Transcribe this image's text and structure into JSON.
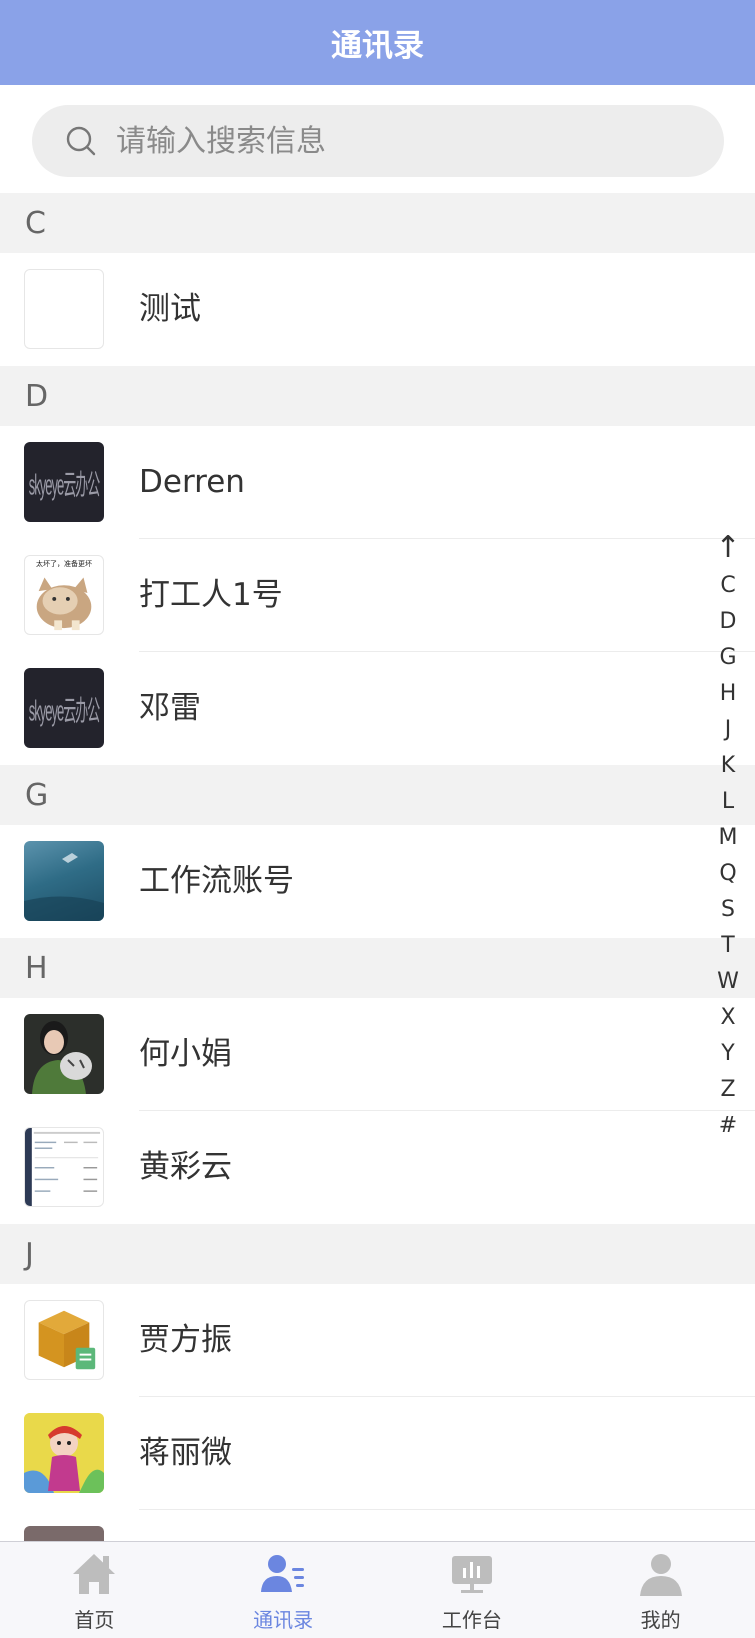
{
  "header": {
    "title": "通讯录"
  },
  "search": {
    "placeholder": "请输入搜索信息",
    "icon": "search-icon"
  },
  "sections": [
    {
      "letter": "C",
      "contacts": [
        {
          "name": "测试",
          "avatar": "blank"
        }
      ]
    },
    {
      "letter": "D",
      "contacts": [
        {
          "name": "Derren",
          "avatar": "skyeye-logo"
        },
        {
          "name": "打工人1号",
          "avatar": "cat-photo",
          "avatar_text": "太坏了，准备更坏"
        },
        {
          "name": "邓雷",
          "avatar": "skyeye-logo"
        }
      ]
    },
    {
      "letter": "G",
      "contacts": [
        {
          "name": "工作流账号",
          "avatar": "ocean-photo"
        }
      ]
    },
    {
      "letter": "H",
      "contacts": [
        {
          "name": "何小娟",
          "avatar": "person-photo"
        },
        {
          "name": "黄彩云",
          "avatar": "screenshot-thumb"
        }
      ]
    },
    {
      "letter": "J",
      "contacts": [
        {
          "name": "贾方振",
          "avatar": "box-icon"
        },
        {
          "name": "蒋丽微",
          "avatar": "cartoon"
        }
      ]
    }
  ],
  "logo_text": "skyeye云办公",
  "index_bar": [
    "↑",
    "C",
    "D",
    "G",
    "H",
    "J",
    "K",
    "L",
    "M",
    "Q",
    "S",
    "T",
    "W",
    "X",
    "Y",
    "Z",
    "#"
  ],
  "tabs": [
    {
      "label": "首页",
      "icon": "home-icon",
      "active": false
    },
    {
      "label": "通讯录",
      "icon": "contacts-icon",
      "active": true
    },
    {
      "label": "工作台",
      "icon": "workbench-icon",
      "active": false
    },
    {
      "label": "我的",
      "icon": "profile-icon",
      "active": false
    }
  ],
  "colors": {
    "accent": "#8aa2e8",
    "active_tab": "#6b86e0",
    "inactive_icon": "#bdbdbd"
  }
}
